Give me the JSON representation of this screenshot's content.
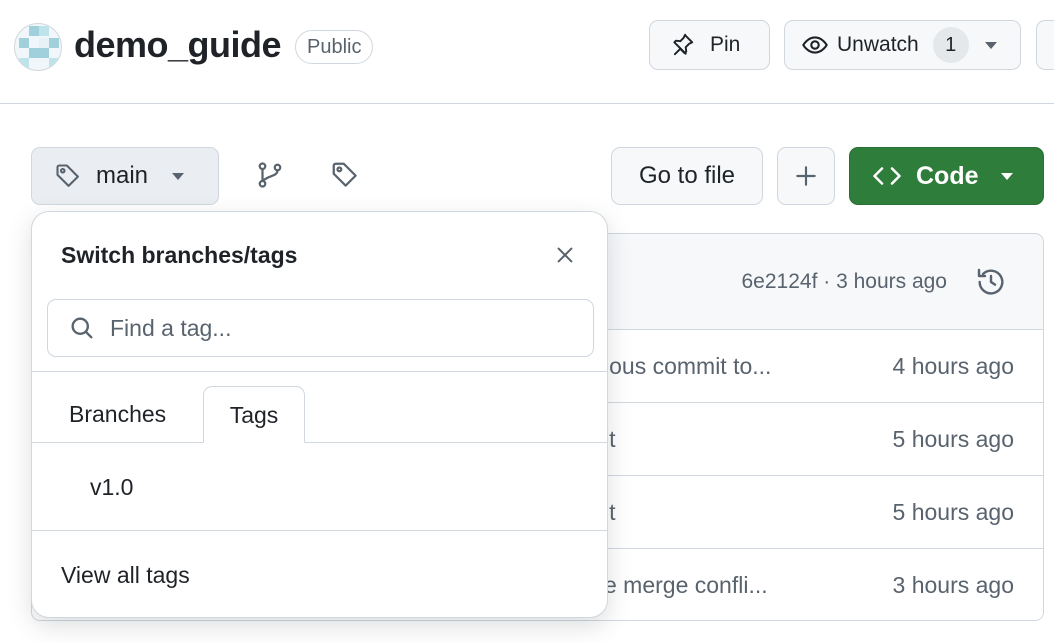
{
  "repo": {
    "name": "demo_guide",
    "visibility": "Public"
  },
  "header_actions": {
    "pin_label": "Pin",
    "watch_label": "Unwatch",
    "watch_count": "1"
  },
  "toolbar": {
    "branch_label": "main",
    "goto_file_label": "Go to file",
    "code_label": "Code",
    "code_color": "#2f7d3b"
  },
  "file_table": {
    "latest_commit": "6e2124f · 3 hours ago",
    "rows": [
      {
        "message": "ious commit to...",
        "time": "4 hours ago"
      },
      {
        "message": "it",
        "time": "5 hours ago"
      },
      {
        "message": "it",
        "time": "5 hours ago"
      },
      {
        "message": "e merge confli...",
        "time": "3 hours ago"
      }
    ]
  },
  "popover": {
    "title": "Switch branches/tags",
    "filter_placeholder": "Find a tag...",
    "tabs": [
      {
        "label": "Branches",
        "active": false
      },
      {
        "label": "Tags",
        "active": true
      }
    ],
    "tags": [
      "v1.0"
    ],
    "view_all_label": "View all tags"
  },
  "icons": {
    "avatar": "identicon",
    "pin": "pin-icon",
    "watch": "eye-icon",
    "branch_tag": "tag-icon",
    "branches": "git-branch-icon",
    "tags": "tag-icon",
    "add": "plus-icon",
    "code": "code-icon",
    "history": "history-icon",
    "search": "search-icon",
    "close": "close-icon"
  }
}
